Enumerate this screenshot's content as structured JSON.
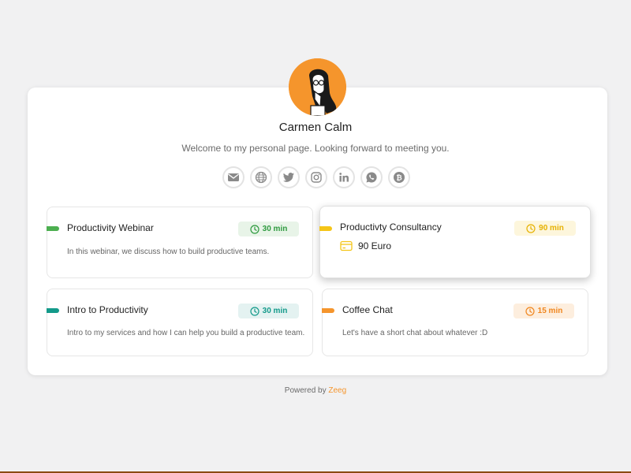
{
  "profile": {
    "name": "Carmen Calm",
    "welcome": "Welcome to my personal page. Looking forward to meeting you."
  },
  "socials": [
    {
      "icon": "email-icon"
    },
    {
      "icon": "globe-icon"
    },
    {
      "icon": "twitter-icon"
    },
    {
      "icon": "instagram-icon"
    },
    {
      "icon": "linkedin-icon"
    },
    {
      "icon": "whatsapp-icon"
    },
    {
      "icon": "bitcoin-icon"
    }
  ],
  "events": [
    {
      "title": "Productivity Webinar",
      "duration": "30 min",
      "description": "In this webinar, we discuss how to build productive teams.",
      "color": "#4caf50",
      "badge_bg": "#e8f4e8"
    },
    {
      "title": "Productivty Consultancy",
      "duration": "90 min",
      "price": "90 Euro",
      "color": "#f5c518",
      "badge_bg": "#fdf6dc"
    },
    {
      "title": "Intro to Productivity",
      "duration": "30 min",
      "description": "Intro to my services and how I can help you build a productive team.",
      "color": "#139a8a",
      "badge_bg": "#e4f2f1"
    },
    {
      "title": "Coffee Chat",
      "duration": "15 min",
      "description": "Let's have a short chat about whatever :D",
      "color": "#f5952c",
      "badge_bg": "#fdeede"
    }
  ],
  "footer": {
    "powered_prefix": "Powered by",
    "brand": "Zeeg"
  },
  "colors": {
    "accent": "#f5952c",
    "page_bg": "#f1f1f2",
    "card_bg": "#ffffff"
  }
}
